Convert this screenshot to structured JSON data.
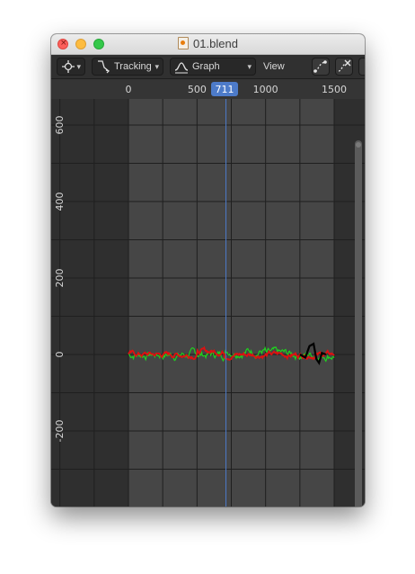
{
  "window": {
    "title": "01.blend"
  },
  "header": {
    "editor_type_icon": "cursor-crosshair-icon",
    "mode_label": "Tracking",
    "mode_icon": "tracking-curve-icon",
    "view_label": "Graph",
    "view_icon": "graph-curve-icon",
    "menu_view": "View",
    "right_icons": [
      "curve-points-icon",
      "curve-delete-icon"
    ]
  },
  "timeline": {
    "frame_ticks": [
      "0",
      "500",
      "1000",
      "1500"
    ],
    "current_frame": "711",
    "value_ticks": [
      "600",
      "400",
      "200",
      "0",
      "-200"
    ],
    "colors": {
      "frame_badge": "#4d7bc9",
      "playhead": "#4d7bc9"
    }
  },
  "chart_data": {
    "type": "line",
    "x_range": [
      0,
      1500
    ],
    "y_range": [
      -300,
      650
    ],
    "current_frame": 711,
    "series": [
      {
        "color": "#1fd11f",
        "amplitude": 18
      },
      {
        "color": "#e01010",
        "amplitude": 12
      },
      {
        "color": "#000000",
        "amplitude": 20
      }
    ]
  }
}
